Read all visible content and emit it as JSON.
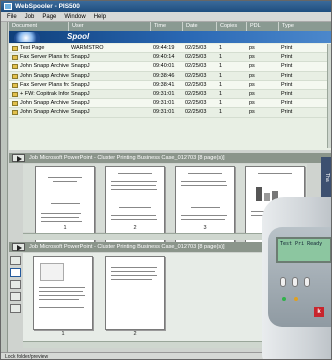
{
  "window": {
    "title": "WebSpooler - PIS500"
  },
  "menu": [
    "File",
    "Job",
    "Page",
    "Window",
    "Help"
  ],
  "jobs": {
    "columns": [
      "Document",
      "User",
      "Time",
      "Date",
      "Copies",
      "PDL",
      "Type"
    ],
    "banner_label": "Spool",
    "rows": [
      {
        "document": "Test Page",
        "user": "WARMSTRO",
        "time": "09:44:19",
        "date": "02/25/03",
        "copies": "1",
        "pdl": "ps",
        "type": "Print"
      },
      {
        "document": "Fax Server Plans from A",
        "user": "SnappJ",
        "time": "09:40:14",
        "date": "02/25/03",
        "copies": "1",
        "pdl": "ps",
        "type": "Print"
      },
      {
        "document": "John Snapp Archive - I",
        "user": "SnappJ",
        "time": "09:40:01",
        "date": "02/25/03",
        "copies": "1",
        "pdl": "ps",
        "type": "Print"
      },
      {
        "document": "John Snapp Archive - I",
        "user": "SnappJ",
        "time": "09:38:46",
        "date": "02/25/03",
        "copies": "1",
        "pdl": "ps",
        "type": "Print"
      },
      {
        "document": "Fax Server Plans from A",
        "user": "SnappJ",
        "time": "09:38:41",
        "date": "02/25/03",
        "copies": "1",
        "pdl": "ps",
        "type": "Print"
      },
      {
        "document": "+ FW: Copitrak Informati",
        "user": "SnappJ",
        "time": "09:31:01",
        "date": "02/25/03",
        "copies": "1",
        "pdl": "ps",
        "type": "Print"
      },
      {
        "document": "John Snapp Archive - I",
        "user": "SnappJ",
        "time": "09:31:01",
        "date": "02/25/03",
        "copies": "1",
        "pdl": "ps",
        "type": "Print"
      },
      {
        "document": "John Snapp Archive - I",
        "user": "SnappJ",
        "time": "09:31:01",
        "date": "02/25/03",
        "copies": "1",
        "pdl": "ps",
        "type": "Print"
      }
    ]
  },
  "preview1": {
    "header": "Job Microsoft PowerPoint - Cluster Printing Business Case_012703 [8 page(s)]",
    "page_numbers": [
      "1",
      "2",
      "3"
    ]
  },
  "preview2": {
    "header": "Job Microsoft PowerPoint - Cluster Printing Business Case_012703 [8 page(s)]",
    "page_numbers": [
      "1",
      "2"
    ]
  },
  "side_tab": "Tha",
  "status": "Lock folder/preview",
  "printer_lcd": "Test Pri Ready"
}
